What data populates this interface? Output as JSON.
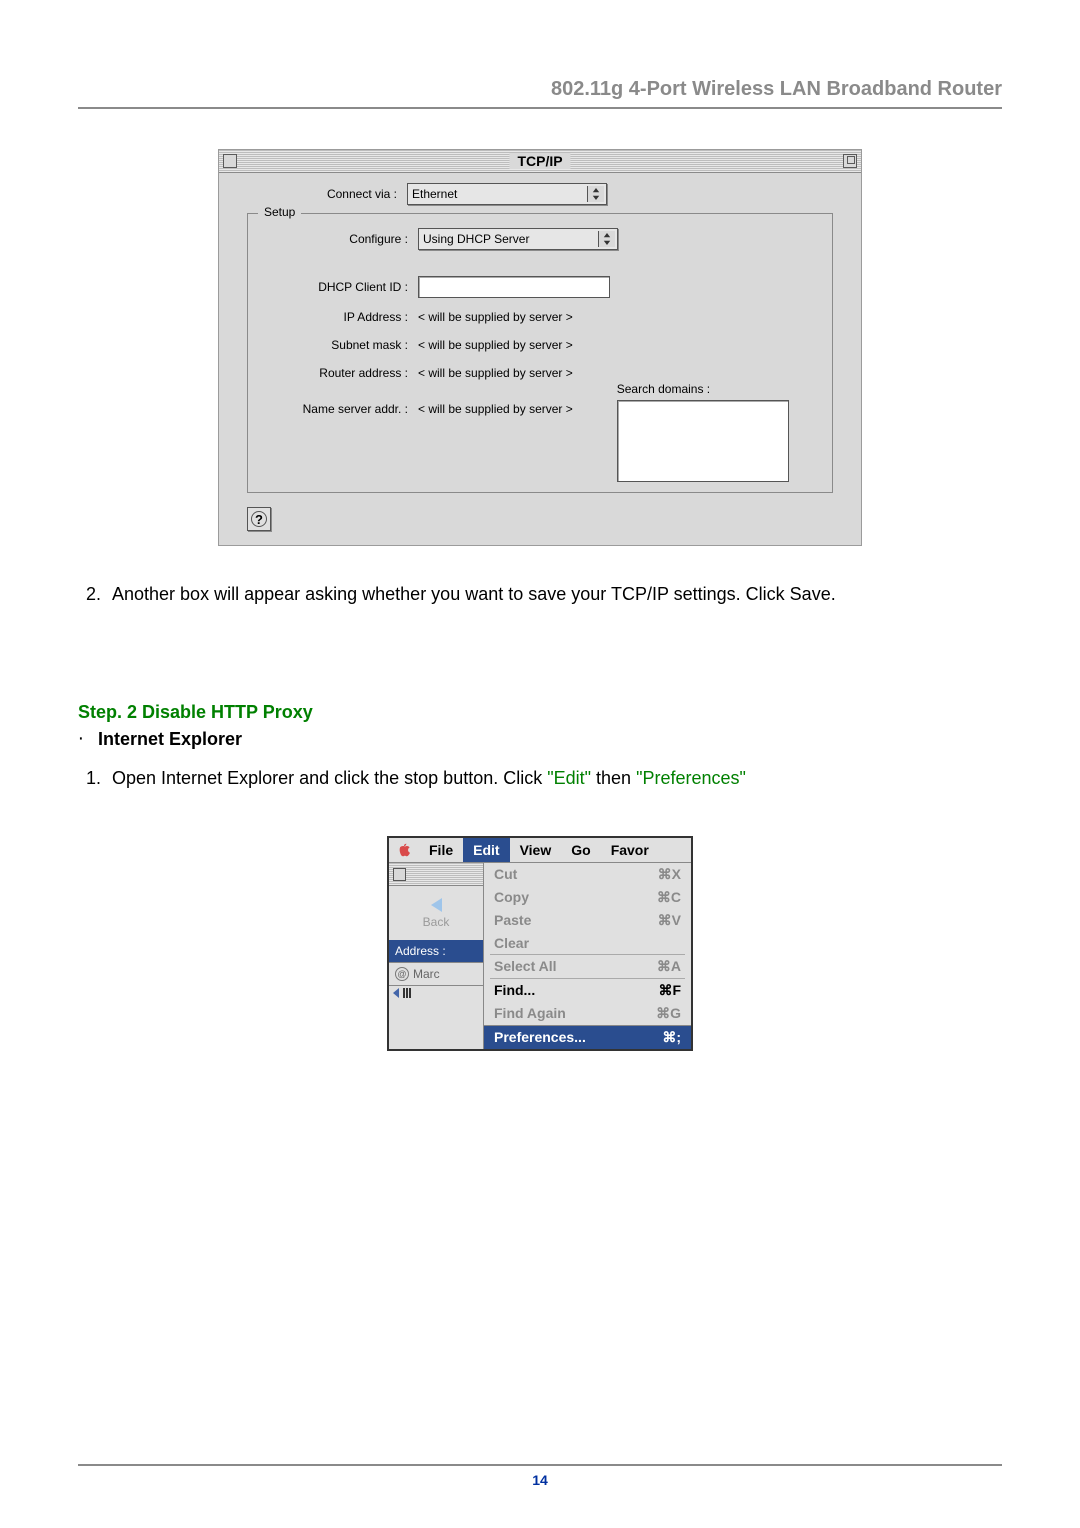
{
  "header": {
    "title": "802.11g 4-Port Wireless LAN Broadband Router"
  },
  "tcpip": {
    "window_title": "TCP/IP",
    "connect_via_label": "Connect via :",
    "connect_via_value": "Ethernet",
    "setup_legend": "Setup",
    "configure_label": "Configure :",
    "configure_value": "Using DHCP Server",
    "dhcp_client_id_label": "DHCP Client ID :",
    "ip_address_label": "IP Address :",
    "ip_address_value": "< will be supplied by server >",
    "subnet_mask_label": "Subnet mask :",
    "subnet_mask_value": "< will be supplied by server >",
    "router_address_label": "Router address :",
    "router_address_value": "< will be supplied by server >",
    "name_server_label": "Name server addr. :",
    "name_server_value": "< will be supplied by server >",
    "search_domains_label": "Search domains :",
    "help_glyph": "?"
  },
  "step1_item2": "Another box will appear asking whether you want to save your TCP/IP settings. Click Save.",
  "step2_title": "Step. 2 Disable HTTP Proxy",
  "step2_bullet": "Internet Explorer",
  "step2_item1_pre": "Open Internet Explorer and click the stop button. Click ",
  "step2_item1_edit": "\"Edit\"",
  "step2_item1_mid": " then ",
  "step2_item1_pref": "\"Preferences\"",
  "ie_menu": {
    "menubar": [
      "File",
      "Edit",
      "View",
      "Go",
      "Favor"
    ],
    "back_label": "Back",
    "address_label": "Address :",
    "marc_label": "Marc",
    "items": [
      {
        "label": "Cut",
        "shortcut": "⌘X",
        "enabled": false
      },
      {
        "label": "Copy",
        "shortcut": "⌘C",
        "enabled": false
      },
      {
        "label": "Paste",
        "shortcut": "⌘V",
        "enabled": false
      },
      {
        "label": "Clear",
        "shortcut": "",
        "enabled": false
      }
    ],
    "items2": [
      {
        "label": "Select All",
        "shortcut": "⌘A",
        "enabled": false
      }
    ],
    "items3": [
      {
        "label": "Find...",
        "shortcut": "⌘F",
        "enabled": true
      },
      {
        "label": "Find Again",
        "shortcut": "⌘G",
        "enabled": false
      }
    ],
    "pref": {
      "label": "Preferences...",
      "shortcut": "⌘;"
    }
  },
  "page_number": "14"
}
